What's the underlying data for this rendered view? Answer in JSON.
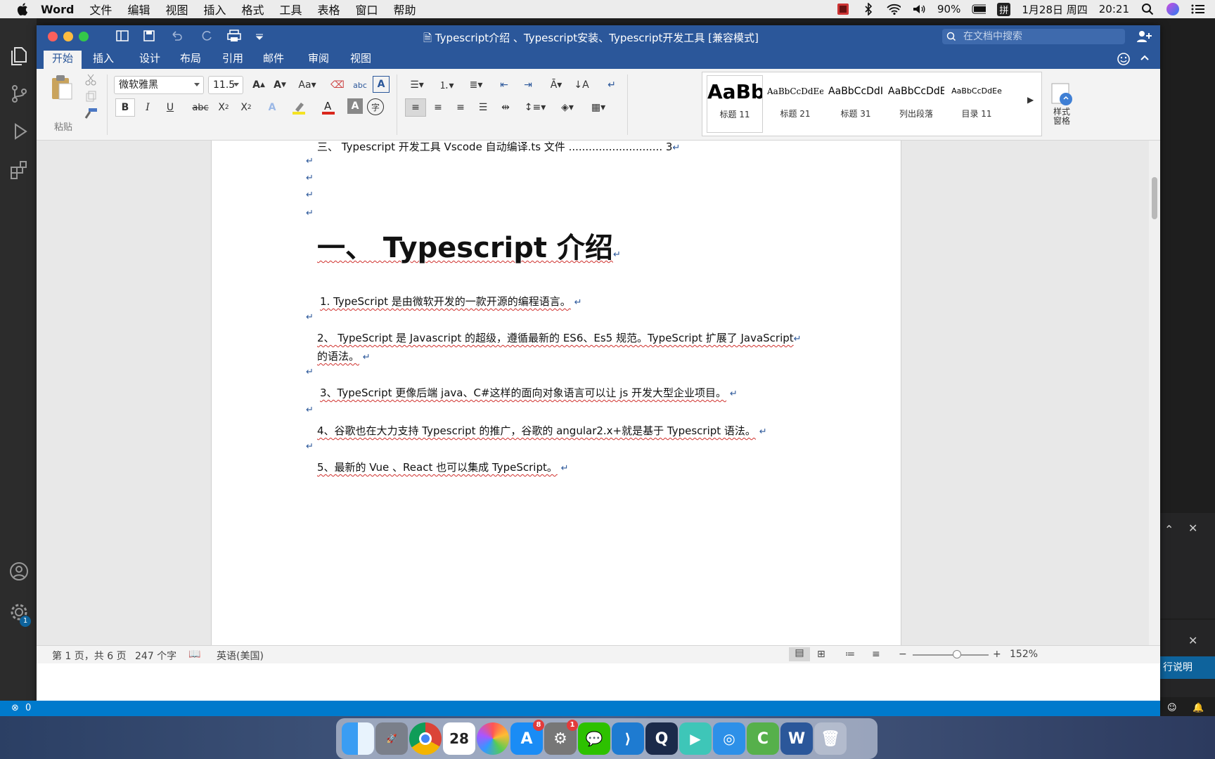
{
  "menubar": {
    "app_name": "Word",
    "items": [
      "文件",
      "编辑",
      "视图",
      "插入",
      "格式",
      "工具",
      "表格",
      "窗口",
      "帮助"
    ],
    "battery": "90%",
    "input_method": "拼",
    "date": "1月28日 周四",
    "time": "20:21"
  },
  "window": {
    "title": "Typescript介绍 、Typescript安装、Typescript开发工具 [兼容模式]",
    "search_placeholder": "在文档中搜索"
  },
  "tabs": [
    "开始",
    "插入",
    "设计",
    "布局",
    "引用",
    "邮件",
    "审阅",
    "视图"
  ],
  "ribbon": {
    "paste_label": "粘贴",
    "font_name": "微软雅黑",
    "font_size": "11.5",
    "styles": [
      {
        "sample": "AaBb",
        "label": "标题 11"
      },
      {
        "sample": "AaBbCcDdEe",
        "label": "标题 21"
      },
      {
        "sample": "AaBbCcDdI",
        "label": "标题 31"
      },
      {
        "sample": "AaBbCcDdEe",
        "label": "列出段落"
      },
      {
        "sample": "AaBbCcDdEe",
        "label": "目录 11"
      }
    ],
    "styles_pane_label": "样式\n窗格"
  },
  "document": {
    "toc_line": "三、 Typescript 开发工具 Vscode 自动编译.ts 文件 ............................ 3",
    "heading": "一、  Typescript 介绍",
    "p1": "1. TypeScript 是由微软开发的一款开源的编程语言。",
    "p2a": "2、 TypeScript 是 Javascript 的超级，遵循最新的 ES6、Es5 规范。TypeScript 扩展了 JavaScript",
    "p2b": "的语法。",
    "p3": "3、TypeScript 更像后端 java、C#这样的面向对象语言可以让 js 开发大型企业项目。",
    "p4": "4、谷歌也在大力支持 Typescript 的推广，谷歌的 angular2.x+就是基于 Typescript 语法。",
    "p5": "5、最新的 Vue 、React 也可以集成 TypeScript。",
    "pilcrow": "↵"
  },
  "status": {
    "page": "第 1 页，共 6 页",
    "words": "247 个字",
    "language": "英语(美国)",
    "zoom": "152%",
    "zoom_value": 0.58
  },
  "vscode": {
    "errors": "0",
    "settings_badge": "1",
    "explain_button": "行说明"
  },
  "dock": {
    "calendar_day": "28",
    "appstore_badge": "8",
    "prefs_badge": "1"
  },
  "colors": {
    "word_blue": "#2b579a",
    "vscode_blue": "#007acc"
  }
}
